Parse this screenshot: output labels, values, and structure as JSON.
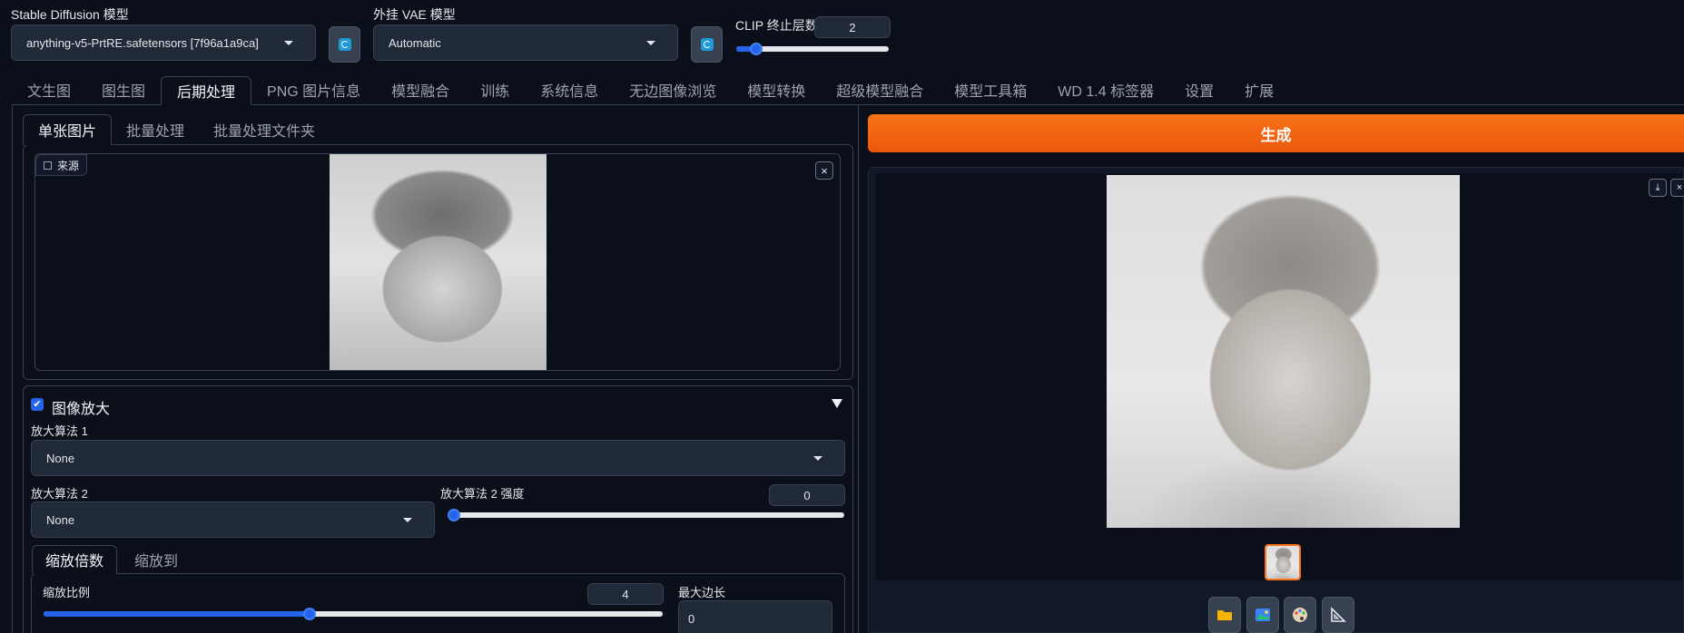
{
  "top": {
    "sd_model_label": "Stable Diffusion 模型",
    "sd_model_value": "anything-v5-PrtRE.safetensors [7f96a1a9ca]",
    "vae_label": "外挂 VAE 模型",
    "vae_value": "Automatic",
    "clip_label": "CLIP 终止层数",
    "clip_value": "2",
    "clip_slider_fraction": 0.08
  },
  "tabs": [
    {
      "label": "文生图"
    },
    {
      "label": "图生图"
    },
    {
      "label": "后期处理"
    },
    {
      "label": "PNG 图片信息"
    },
    {
      "label": "模型融合"
    },
    {
      "label": "训练"
    },
    {
      "label": "系统信息"
    },
    {
      "label": "无边图像浏览"
    },
    {
      "label": "模型转换"
    },
    {
      "label": "超级模型融合"
    },
    {
      "label": "模型工具箱"
    },
    {
      "label": "WD 1.4 标签器"
    },
    {
      "label": "设置"
    },
    {
      "label": "扩展"
    }
  ],
  "active_tab": "后期处理",
  "left": {
    "subtabs": [
      "单张图片",
      "批量处理",
      "批量处理文件夹"
    ],
    "source_label": "来源",
    "close_symbol": "×",
    "upscale": {
      "title": "图像放大",
      "checked": true,
      "upscaler1_label": "放大算法 1",
      "upscaler1_value": "None",
      "upscaler2_label": "放大算法 2",
      "upscaler2_value": "None",
      "upscaler2_strength_label": "放大算法 2 强度",
      "upscaler2_strength_value": "0",
      "upscaler2_strength_fraction": 0.0,
      "resize_tabs": [
        "缩放倍数",
        "缩放到"
      ],
      "scale_label": "缩放比例",
      "scale_value": "4",
      "scale_fraction": 0.43,
      "max_side_label": "最大边长",
      "max_side_value": "0"
    }
  },
  "right": {
    "generate_label": "生成",
    "download_symbol": "⤓",
    "close_symbol": "×",
    "tools": [
      {
        "icon": "folder-icon"
      },
      {
        "icon": "image-icon"
      },
      {
        "icon": "palette-icon"
      },
      {
        "icon": "ruler-icon"
      }
    ]
  },
  "colors": {
    "background": "#0b0f19",
    "accent_orange": "#f97316",
    "accent_blue": "#2563eb"
  }
}
